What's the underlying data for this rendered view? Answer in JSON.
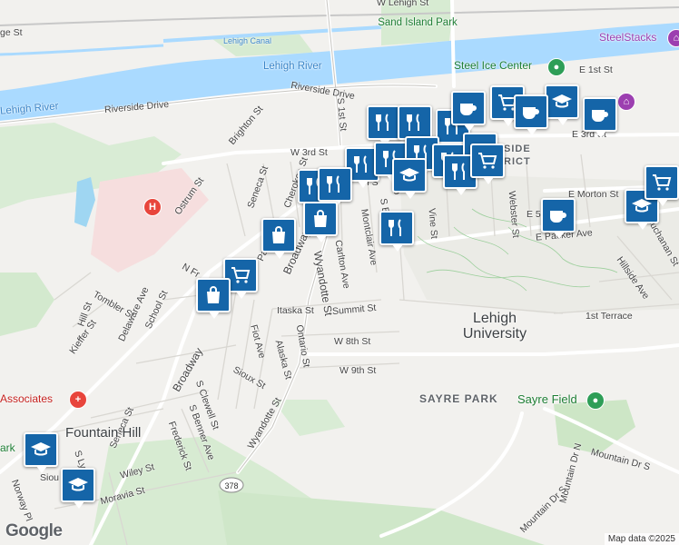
{
  "map": {
    "street_labels": [
      "W Lehigh St",
      "Lehigh Canal",
      "Lehigh River",
      "Riverside Drive",
      "Riverside Drive",
      "Brighton St",
      "W 3rd St",
      "Seneca St",
      "Cherokee St",
      "Ostrum St",
      "Delaware Ave",
      "School St",
      "Tombler St",
      "Hill St",
      "Kieffer St",
      "Broadway",
      "Broadway",
      "Wyandotte St",
      "Wyandotte St",
      "Carlton Ave",
      "Montclair Ave",
      "Vine St",
      "Webster St",
      "E Morton St",
      "E Packer Ave",
      "Hillside Ave",
      "Itaska St",
      "Summit St",
      "W 8th St",
      "W 9th St",
      "Fiot Ave",
      "Alaska St",
      "Ontario St",
      "Sioux St",
      "S Clewell St",
      "S Benner Ave",
      "Frederick St",
      "Wiley St",
      "Moravia St",
      "Norway Pl",
      "Mountain Dr N",
      "Mountain Dr S",
      "Mountain Dr S",
      "1st Terrace",
      "E 1st St",
      "E 3rd St",
      "Seneca St",
      "S Ly",
      "Siou",
      "Pa",
      "N Fr",
      "E 5",
      "S Bi",
      "Bro",
      "Buchanan St",
      "th S",
      "ge St",
      "S 1st St"
    ],
    "place_labels": [
      "Sand Island Park",
      "SteelStacks",
      "Steel Ice Center",
      "Lehigh University",
      "SAYRE PARK",
      "Sayre Field",
      "Fountain Hill",
      "SIDE",
      "RIC",
      "RICT",
      "Associates",
      "ark"
    ],
    "route_shield": "378",
    "icons": [
      "restaurant-icon",
      "school-icon",
      "coffee-icon",
      "shopping-cart-icon",
      "shopping-bag-icon",
      "hospital-icon",
      "museum-icon",
      "park-icon"
    ]
  },
  "footer": {
    "logo": "Google",
    "attribution": "Map data ©2025"
  }
}
